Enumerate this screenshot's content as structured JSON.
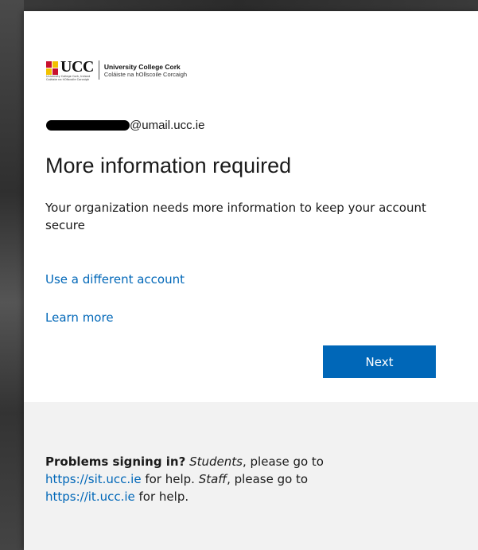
{
  "logo": {
    "wordmark": "UCC",
    "small_line1": "University College Cork, Ireland",
    "small_line2": "Coláiste na hOllscoile Corcaigh",
    "name": "University College Cork",
    "irish_name": "Coláiste na hOllscoile Corcaigh"
  },
  "identity": {
    "email_suffix": "@umail.ucc.ie"
  },
  "main": {
    "title": "More information required",
    "description": "Your organization needs more information to keep your account secure",
    "link_different_account": "Use a different account",
    "link_learn_more": "Learn more",
    "next_label": "Next"
  },
  "footer": {
    "problems_label": "Problems signing in?",
    "students_label": "Students",
    "text_please_go_to_1": ", please go to ",
    "sit_url": "https://sit.ucc.ie",
    "text_for_help_1": " for help. ",
    "staff_label": "Staff",
    "text_please_go_to_2": ", please go to ",
    "it_url": "https://it.ucc.ie",
    "text_for_help_2": " for help."
  },
  "colors": {
    "accent": "#0067b8",
    "footer_background": "#f2f2f2",
    "text": "#1b1b1b"
  },
  "icons": {
    "crest": "ucc-crest-icon"
  }
}
